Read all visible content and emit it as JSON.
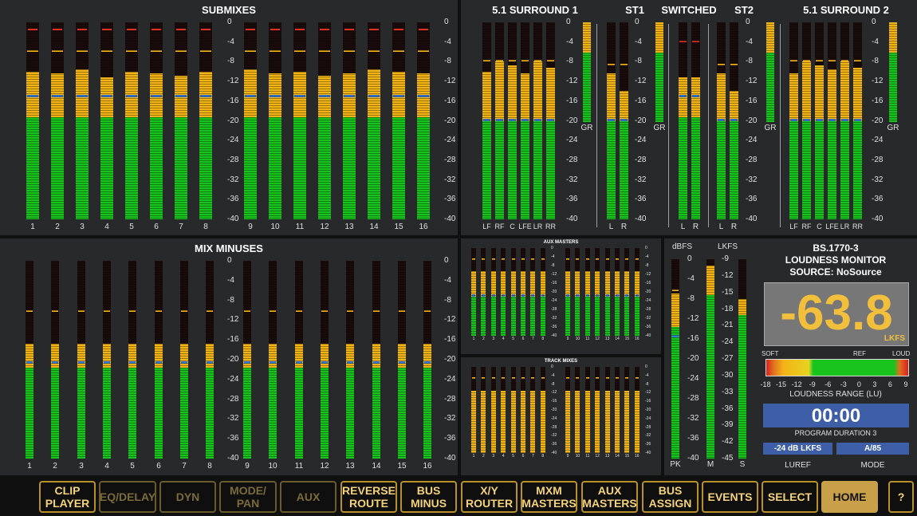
{
  "panels": {
    "submixes": {
      "title": "SUBMIXES",
      "channels": [
        "1",
        "2",
        "3",
        "4",
        "5",
        "6",
        "7",
        "8",
        "9",
        "10",
        "11",
        "12",
        "13",
        "14",
        "15",
        "16"
      ]
    },
    "mix_minuses": {
      "title": "MIX MINUSES",
      "channels": [
        "1",
        "2",
        "3",
        "4",
        "5",
        "6",
        "7",
        "8",
        "9",
        "10",
        "11",
        "12",
        "13",
        "14",
        "15",
        "16"
      ]
    },
    "surround1": {
      "title": "5.1 SURROUND 1",
      "channels": [
        "LF",
        "RF",
        "C",
        "LFE",
        "LR",
        "RR"
      ]
    },
    "st1": {
      "title": "ST1",
      "channels": [
        "L",
        "R"
      ]
    },
    "switched": {
      "title": "SWITCHED",
      "channels": [
        "L",
        "R"
      ]
    },
    "st2": {
      "title": "ST2",
      "channels": [
        "L",
        "R"
      ]
    },
    "surround2": {
      "title": "5.1 SURROUND 2",
      "channels": [
        "LF",
        "RF",
        "C",
        "LFE",
        "LR",
        "RR"
      ]
    },
    "gr_label": "GR",
    "aux_masters": {
      "title": "AUX MASTERS"
    },
    "track_mixes": {
      "title": "TRACK MIXES"
    }
  },
  "scale_db": [
    "0",
    "-4",
    "-8",
    "-12",
    "-16",
    "-20",
    "-24",
    "-28",
    "-32",
    "-36",
    "-40"
  ],
  "loudness": {
    "title1": "BS.1770-3",
    "title2": "LOUDNESS MONITOR",
    "source": "SOURCE: NoSource",
    "dbfs_label": "dBFS",
    "lkfs_label": "LKFS",
    "dbfs_scale": [
      "0",
      "-4",
      "-8",
      "-12",
      "-16",
      "-20",
      "-24",
      "-28",
      "-32",
      "-36",
      "-40"
    ],
    "lkfs_scale": [
      "-9",
      "-12",
      "-15",
      "-18",
      "-21",
      "-24",
      "-27",
      "-30",
      "-33",
      "-36",
      "-39",
      "-42",
      "-45"
    ],
    "meter_labels": [
      "PK",
      "M",
      "S"
    ],
    "value": "-63.8",
    "value_unit": "LKFS",
    "soft": "SOFT",
    "ref": "REF",
    "loud": "LOUD",
    "range_ticks": [
      "-18",
      "-15",
      "-12",
      "-9",
      "-6",
      "-3",
      "0",
      "3",
      "6",
      "9"
    ],
    "range_label": "LOUDNESS RANGE (LU)",
    "duration": "00:00",
    "duration_label": "PROGRAM DURATION 3",
    "luref_value": "-24 dB LKFS",
    "mode_value": "A/85",
    "luref_label": "LUREF",
    "mode_label": "MODE"
  },
  "buttons": [
    {
      "label": "CLIP PLAYER",
      "state": "normal"
    },
    {
      "label": "EQ/DELAY",
      "state": "dim"
    },
    {
      "label": "DYN",
      "state": "dim"
    },
    {
      "label": "MODE/ PAN",
      "state": "dim"
    },
    {
      "label": "AUX",
      "state": "dim"
    },
    {
      "label": "REVERSE ROUTE",
      "state": "normal"
    },
    {
      "label": "BUS MINUS",
      "state": "normal"
    },
    {
      "label": "X/Y ROUTER",
      "state": "normal"
    },
    {
      "label": "MXM MASTERS",
      "state": "normal"
    },
    {
      "label": "AUX MASTERS",
      "state": "normal"
    },
    {
      "label": "BUS ASSIGN",
      "state": "normal"
    },
    {
      "label": "EVENTS",
      "state": "normal"
    },
    {
      "label": "SELECT",
      "state": "normal"
    },
    {
      "label": "HOME",
      "state": "active"
    },
    {
      "label": "?",
      "state": "normal"
    }
  ],
  "colors": {
    "green": "#19c31e",
    "yellow": "#f2b316",
    "blue": "#3a7bd5",
    "red": "#e03020",
    "panel": "#27292b",
    "button_border": "#b8912c"
  }
}
